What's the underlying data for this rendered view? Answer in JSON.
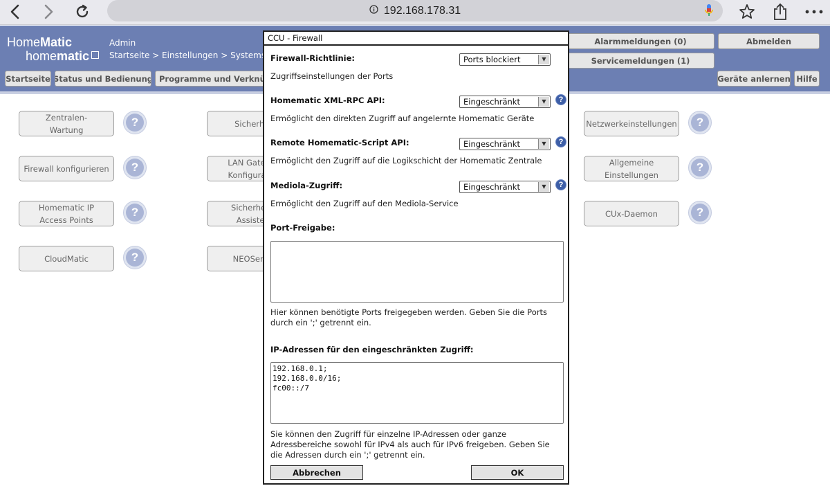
{
  "browser": {
    "url": "192.168.178.31"
  },
  "header": {
    "logo_top_a": "Home",
    "logo_top_b": "Matic",
    "logo_bottom_a": "home",
    "logo_bottom_b": "matic",
    "user": "Admin",
    "breadcrumb": "Startseite > Einstellungen > Systemsteuerung",
    "alarm_label": "Alarmmeldungen (0)",
    "logout_label": "Abmelden",
    "service_label": "Servicemeldungen (1)",
    "menu": {
      "home": "Startseite",
      "status": "Status und Bedienung",
      "programs": "Programme und Verknüpfungen",
      "learn": "Geräte anlernen",
      "help": "Hilfe"
    }
  },
  "tiles": {
    "col1": [
      "Zentralen-\nWartung",
      "Firewall konfigurieren",
      "Homematic IP\nAccess Points",
      "CloudMatic"
    ],
    "col2": [
      "Sicherheit",
      "LAN Gateway\nKonfiguration",
      "Sicherheits-\nAssistent",
      "NEOServer"
    ],
    "col3": [
      "Netzwerkeinstellungen",
      "Allgemeine\nEinstellungen",
      "CUx-Daemon"
    ],
    "help_icon": "?"
  },
  "dialog": {
    "title": "CCU - Firewall",
    "policy_label": "Firewall-Richtlinie:",
    "policy_value": "Ports blockiert",
    "policy_desc": "Zugriffseinstellungen der Ports",
    "xmlrpc_label": "Homematic XML-RPC API:",
    "xmlrpc_value": "Eingeschränkt",
    "xmlrpc_desc": "Ermöglicht den direkten Zugriff auf angelernte Homematic Geräte",
    "script_label": "Remote Homematic-Script API:",
    "script_value": "Eingeschränkt",
    "script_desc": "Ermöglicht den Zugriff auf die Logikschicht der Homematic Zentrale",
    "mediola_label": "Mediola-Zugriff:",
    "mediola_value": "Eingeschränkt",
    "mediola_desc": "Ermöglicht den Zugriff auf den Mediola-Service",
    "ports_label": "Port-Freigabe:",
    "ports_value": "",
    "ports_desc": "Hier können benötigte Ports freigegeben werden. Geben Sie die Ports durch ein ';' getrennt ein.",
    "ip_label": "IP-Adressen für den eingeschränkten Zugriff:",
    "ip_value": "192.168.0.1;\n192.168.0.0/16;\nfc00::/7",
    "ip_desc": "Sie können den Zugriff für einzelne IP-Adressen oder ganze Adressbereiche sowohl für IPv4 als auch für IPv6 freigeben. Geben Sie die Adressen durch ein ';' getrennt ein.",
    "cancel_label": "Abbrechen",
    "ok_label": "OK",
    "help_badge": "?"
  },
  "colors": {
    "header_bg": "#6c7fb3",
    "help_blue": "#3e5fa7"
  }
}
